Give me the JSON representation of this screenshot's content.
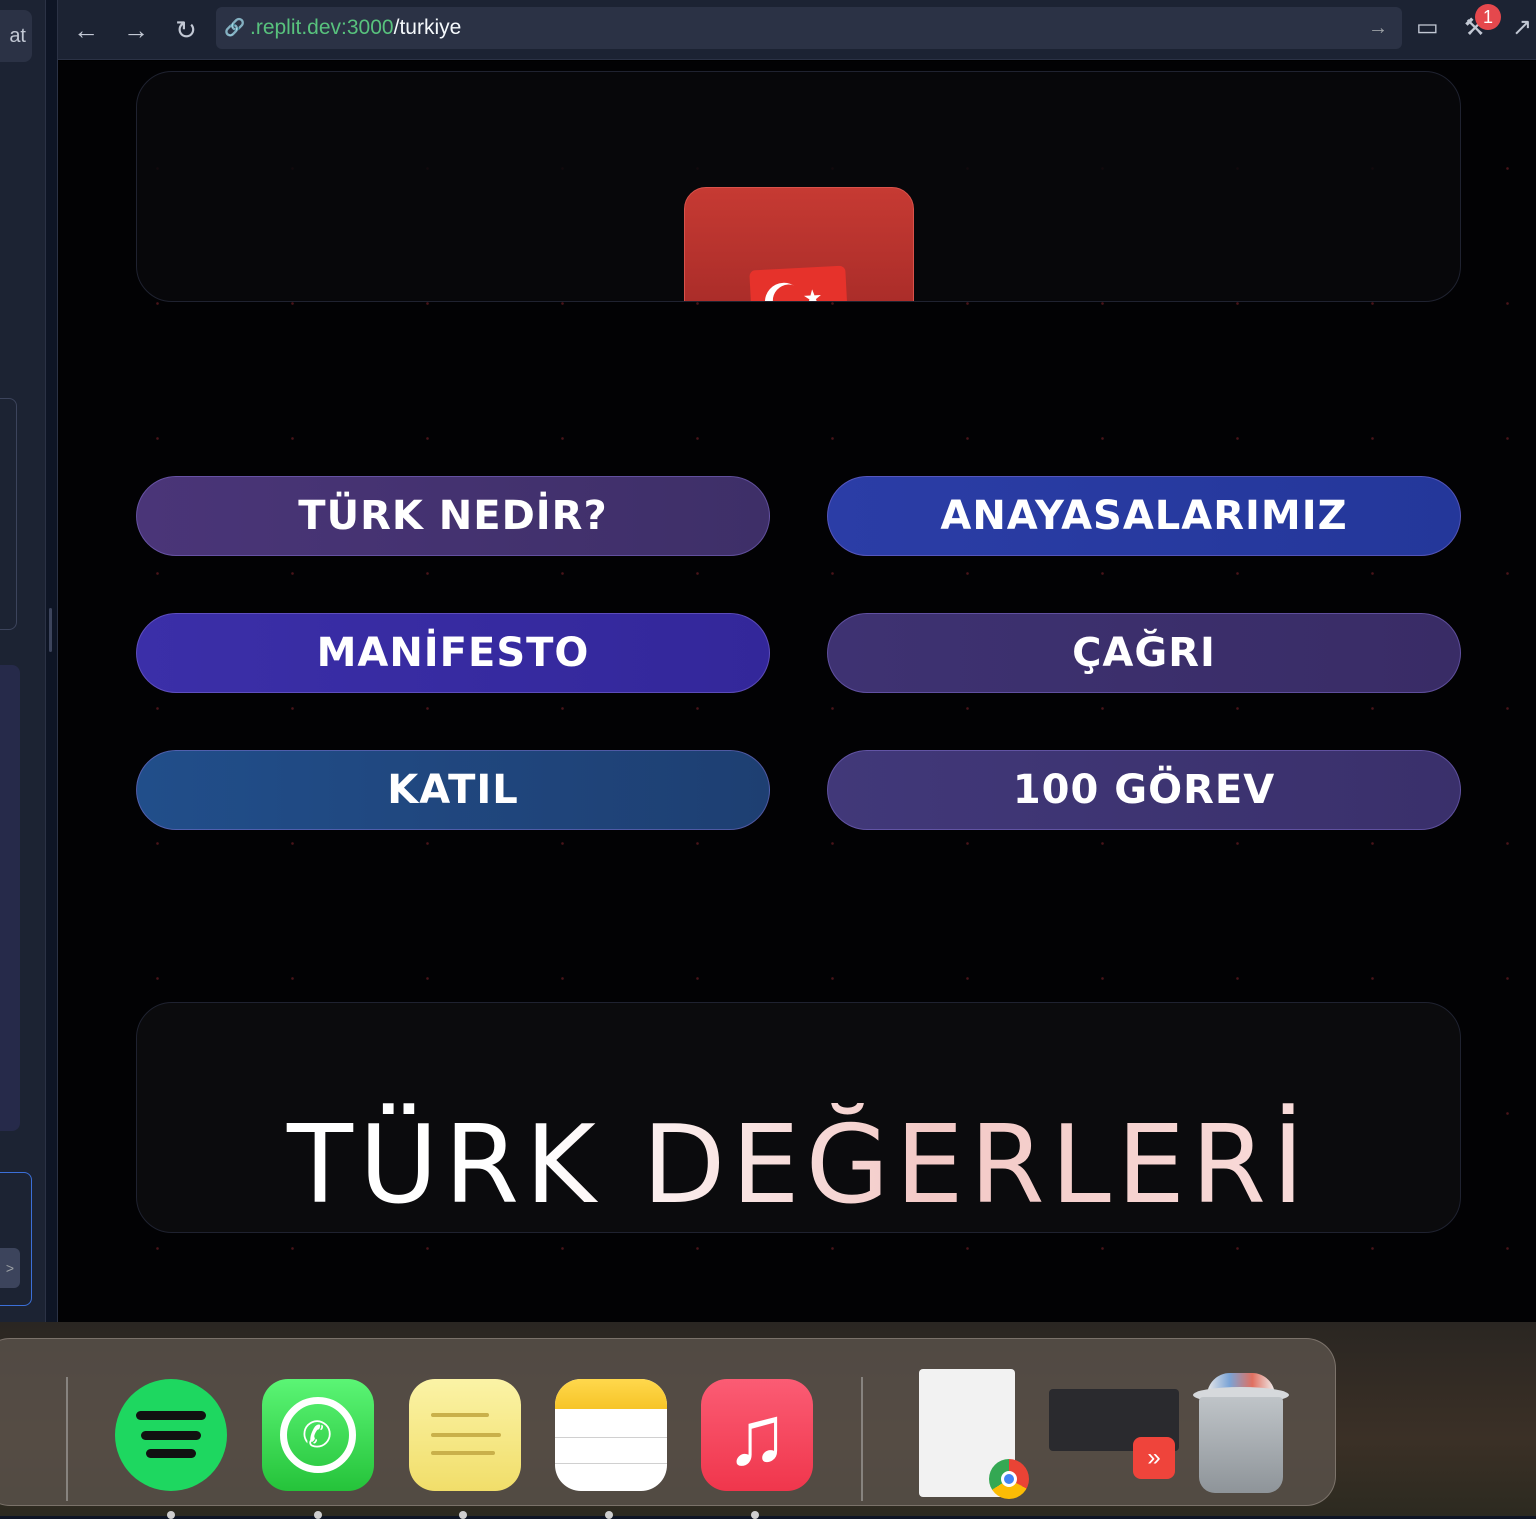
{
  "left_panel": {
    "tab_label": "at",
    "chevrons": [
      "›",
      "›",
      "›"
    ],
    "send_icon": "send-arrow-icon"
  },
  "browser": {
    "back_icon": "←",
    "forward_icon": "→",
    "reload_icon": "↻",
    "url_host": ".replit.dev:3000",
    "url_path": "/turkiye",
    "go_icon": "→",
    "devices_icon": "▭",
    "tools_icon": "⚒",
    "tools_badge": "1",
    "open_tab_icon": "↗"
  },
  "page": {
    "hero_flag": "turkey-flag",
    "nav_buttons": [
      {
        "label": "TÜRK NEDİR?"
      },
      {
        "label": "ANAYASALARIMIZ"
      },
      {
        "label": "MANİFESTO"
      },
      {
        "label": "ÇAĞRI"
      },
      {
        "label": "KATIL"
      },
      {
        "label": "100 GÖREV"
      }
    ],
    "values_title": "TÜRK DEĞERLERİ"
  },
  "dock": {
    "apps": [
      "Spotify",
      "WhatsApp",
      "Stickies",
      "Notes",
      "Music"
    ],
    "windows": [
      "Chrome window",
      "AnyDesk window"
    ],
    "trash": "Trash",
    "music_glyph": "♫",
    "anydesk_glyph": "»"
  },
  "colors": {
    "accent_green": "#58c27d",
    "flag_red": "#e6322b",
    "badge_red": "#e5484d"
  }
}
